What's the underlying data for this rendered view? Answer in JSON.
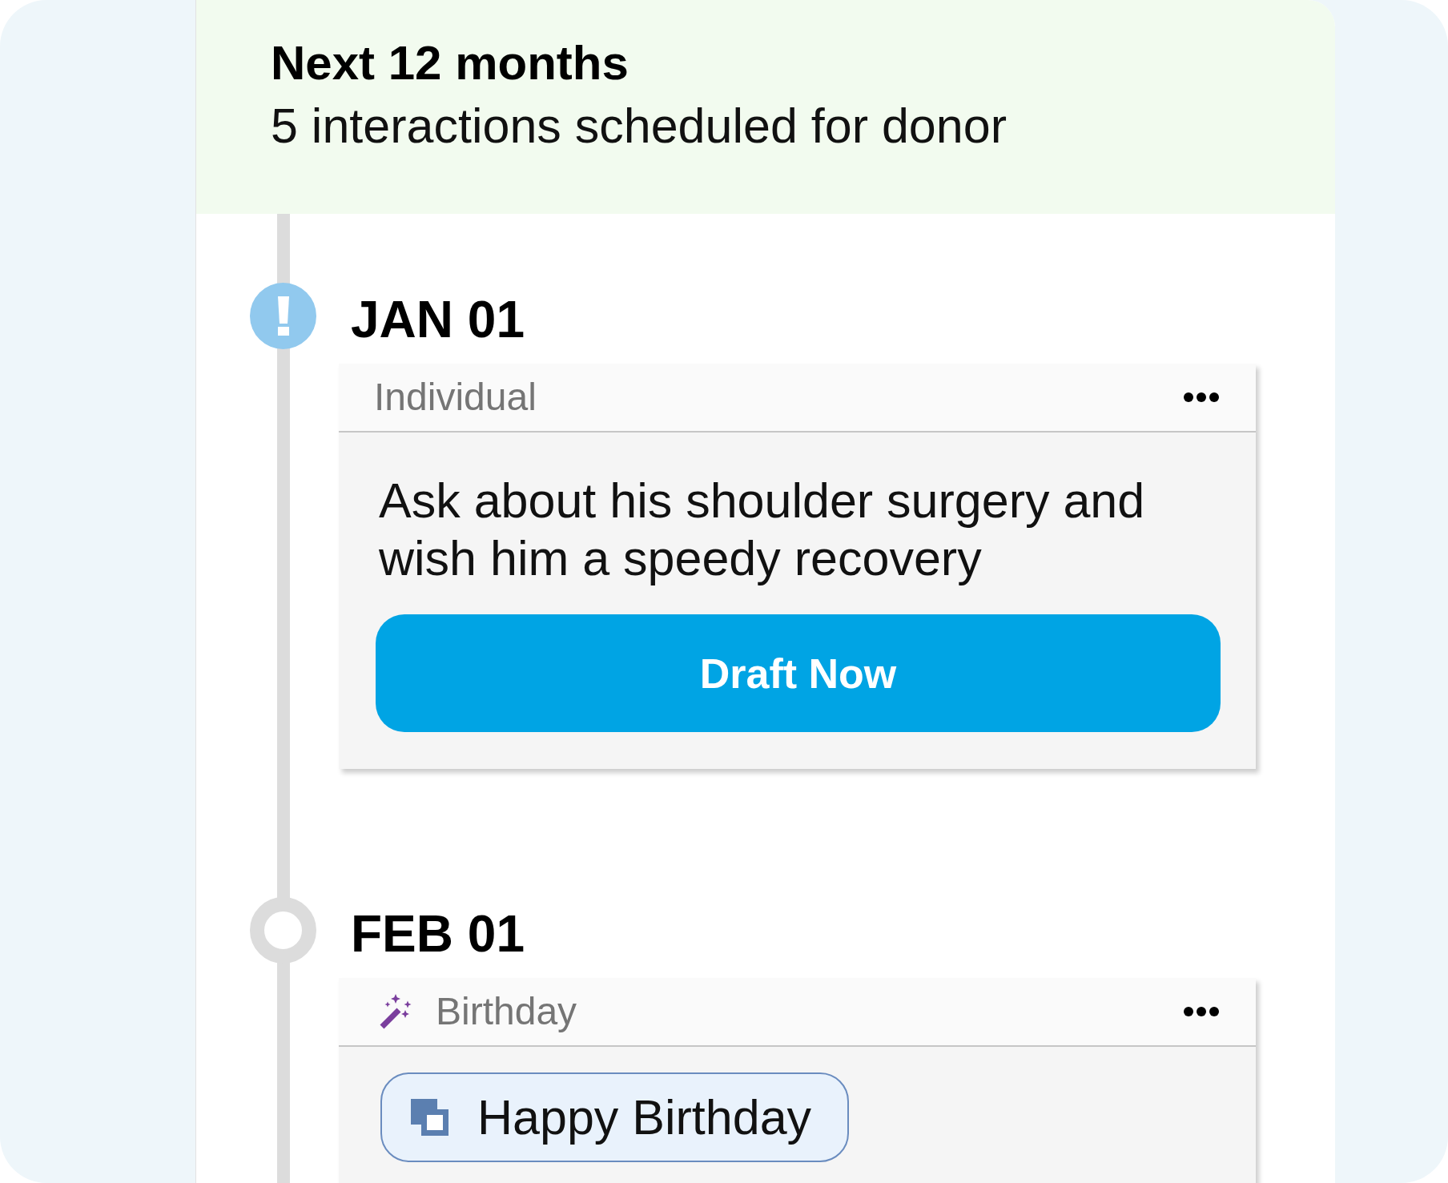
{
  "header": {
    "title": "Next 12 months",
    "subtitle": "5 interactions scheduled for donor"
  },
  "timeline": [
    {
      "date": "JAN 01",
      "alert": true,
      "card": {
        "kind": "task",
        "category": "Individual",
        "message": "Ask about his shoulder surgery and wish him a speedy recovery",
        "action": "Draft Now"
      }
    },
    {
      "date": "FEB 01",
      "alert": false,
      "card": {
        "kind": "template",
        "category": "Birthday",
        "template": "Happy Birthday"
      }
    }
  ]
}
